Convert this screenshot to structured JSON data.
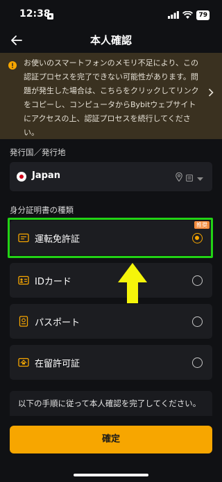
{
  "status_bar": {
    "time": "12:38",
    "battery": "79"
  },
  "header": {
    "title": "本人確認"
  },
  "warning": {
    "text": "お使いのスマートフォンのメモリ不足により、この認証プロセスを完了できない可能性があります。問題が発生した場合は、こちらをクリックしてリンクをコピーし、コンピュータからBybitウェブサイトにアクセスの上、認証プロセスを続行してください。"
  },
  "country_section": {
    "label": "発行国／発行地",
    "selected_country": "Japan"
  },
  "document_section": {
    "label": "身分証明書の種類",
    "options": [
      {
        "label": "運転免許証",
        "icon": "drivers-license-icon",
        "selected": true,
        "badge": "推奨"
      },
      {
        "label": "IDカード",
        "icon": "id-card-icon",
        "selected": false
      },
      {
        "label": "パスポート",
        "icon": "passport-icon",
        "selected": false
      },
      {
        "label": "在留許可証",
        "icon": "residence-permit-icon",
        "selected": false
      }
    ]
  },
  "instruction": {
    "text": "以下の手順に従って本人確認を完了してください。"
  },
  "confirm_button": {
    "label": "確定"
  },
  "colors": {
    "accent": "#f7a600",
    "highlight": "#22d315",
    "annotation_arrow": "#f5f50a",
    "background": "#101114"
  }
}
